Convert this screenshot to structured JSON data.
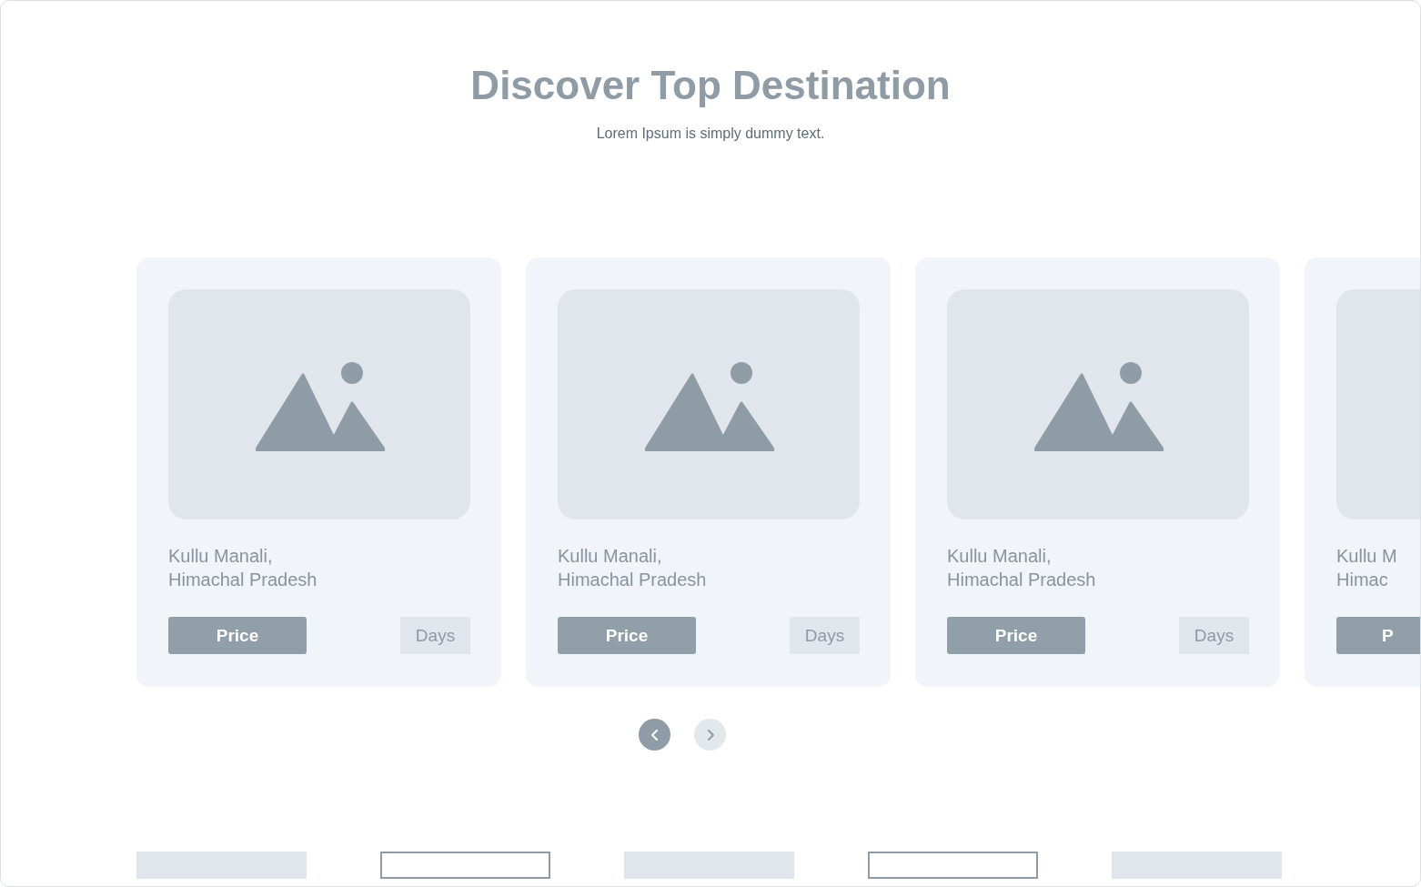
{
  "heading": {
    "title": "Discover Top Destination",
    "subtitle": "Lorem Ipsum is simply dummy text."
  },
  "cards": [
    {
      "kind": "full",
      "name": [
        "Kullu Manali,",
        "Himachal Pradesh"
      ],
      "price": "Price",
      "days": "Days"
    },
    {
      "kind": "full",
      "name": [
        "Kullu Manali,",
        "Himachal Pradesh"
      ],
      "price": "Price",
      "days": "Days"
    },
    {
      "kind": "full",
      "name": [
        "Kullu Manali,",
        "Himachal Pradesh"
      ],
      "price": "Price",
      "days": "Days"
    },
    {
      "kind": "partial",
      "name": [
        "Kullu M",
        "Himac"
      ],
      "price": "P"
    }
  ],
  "pager": [
    {
      "kind": "previous",
      "active": true
    },
    {
      "kind": "next",
      "active": false
    }
  ],
  "bottom_buttons": [
    {
      "kind": "filled"
    },
    {
      "kind": "outlined"
    },
    {
      "kind": "filled"
    },
    {
      "kind": "outlined"
    },
    {
      "kind": "filled"
    }
  ]
}
